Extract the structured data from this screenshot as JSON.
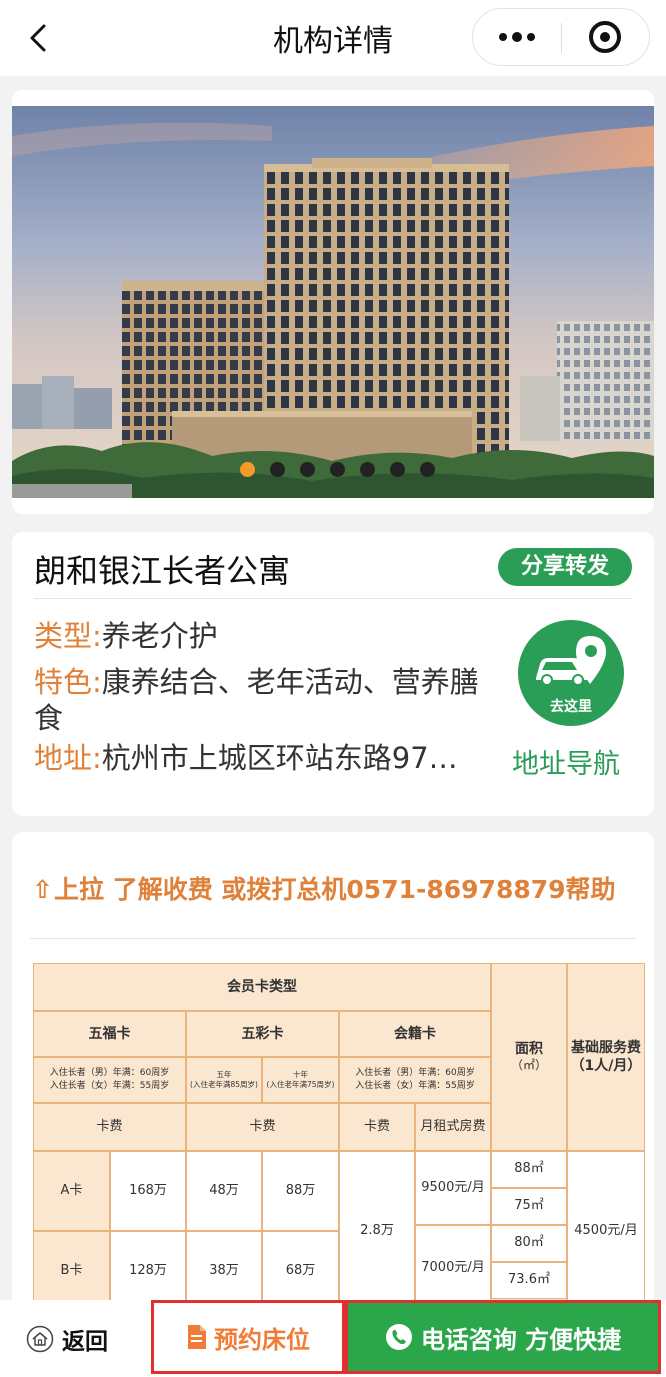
{
  "nav": {
    "title": "机构详情"
  },
  "banner": {
    "dot_count": 7,
    "active_dot": 0
  },
  "institution": {
    "name": "朗和银江长者公寓",
    "share_label": "分享转发",
    "type_key": "类型:",
    "type_value": "养老介护",
    "feature_key": "特色:",
    "feature_value": "康养结合、老年活动、营养膳食",
    "address_key": "地址:",
    "address_value": "杭州市上城区环站东路97…",
    "goto_label": "去这里",
    "nav_link": "地址导航"
  },
  "fees": {
    "tip": "上拉 了解收费 或拨打总机0571-86978879帮助",
    "table": {
      "title": "会员卡类型",
      "card1": "五福卡",
      "card2": "五彩卡",
      "card3": "会籍卡",
      "area": "面积",
      "area_unit": "（㎡）",
      "service": "基础服务费",
      "service_unit": "（1人/月）",
      "card1_cond": "入住长者（男）年满：60周岁\n入住长者（女）年满：55周岁",
      "card2_5y": "五年\n(入住老年满85周岁)",
      "card2_10y": "十年\n(入住老年满75周岁)",
      "card3_cond": "入住长者（男）年满：60周岁\n入住长者（女）年满：55周岁",
      "fee_label": "卡费",
      "monthly_label": "月租式房费",
      "row_a": "A卡",
      "a_card1": "168万",
      "a_card2_5y": "48万",
      "a_card2_10y": "88万",
      "card3_fee": "2.8万",
      "rent1": "9500元/月",
      "rent2": "7000元/月",
      "area1": "88㎡",
      "area2": "75㎡",
      "area3": "80㎡",
      "area4": "73.6㎡",
      "service_fee": "4500元/月",
      "row_b": "B卡",
      "b_card1": "128万",
      "b_card2_5y": "38万",
      "b_card2_10y": "68万"
    }
  },
  "bottom": {
    "back_label": "返回",
    "reserve_label": "预约床位",
    "call_label": "电话咨询 方便快捷"
  },
  "colors": {
    "accent_orange": "#e0813a",
    "green": "#2a9d56",
    "table_bg": "#fbe6cf",
    "highlight_red": "#e03131"
  }
}
